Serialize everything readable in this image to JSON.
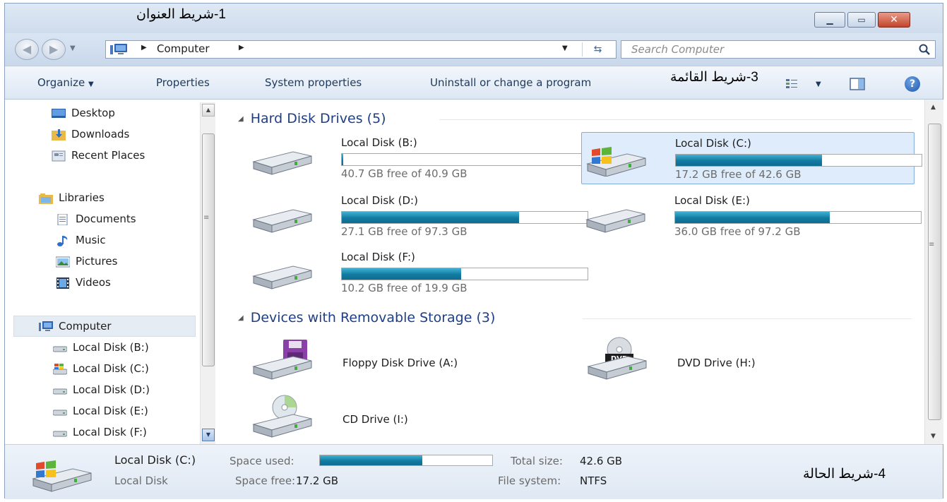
{
  "annotations": {
    "title_bar": "1-شريط العنوان",
    "menu_bar": "3-شريط القائمة",
    "status_bar": "4-شريط الحالة"
  },
  "address_bar": {
    "path": [
      "Computer"
    ],
    "search_placeholder": "Search Computer"
  },
  "command_bar": {
    "items": [
      "Organize",
      "Properties",
      "System properties",
      "Uninstall or change a program"
    ]
  },
  "navigation": {
    "favorites": [
      "Desktop",
      "Downloads",
      "Recent Places"
    ],
    "libraries_label": "Libraries",
    "libraries": [
      "Documents",
      "Music",
      "Pictures",
      "Videos"
    ],
    "computer_label": "Computer",
    "drives": [
      "Local Disk (B:)",
      "Local Disk (C:)",
      "Local Disk (D:)",
      "Local Disk (E:)",
      "Local Disk (F:)"
    ]
  },
  "groups": {
    "hard_disks_header": "Hard Disk Drives (5)",
    "removable_header": "Devices with Removable Storage (3)"
  },
  "hard_disks": [
    {
      "name": "Local Disk (B:)",
      "free_text": "40.7 GB free of 40.9 GB",
      "used_fraction": 0.005,
      "selected": false
    },
    {
      "name": "Local Disk (C:)",
      "free_text": "17.2 GB free of 42.6 GB",
      "used_fraction": 0.596,
      "selected": true
    },
    {
      "name": "Local Disk (D:)",
      "free_text": "27.1 GB free of 97.3 GB",
      "used_fraction": 0.721,
      "selected": false
    },
    {
      "name": "Local Disk (E:)",
      "free_text": "36.0 GB free of 97.2 GB",
      "used_fraction": 0.63,
      "selected": false
    },
    {
      "name": "Local Disk (F:)",
      "free_text": "10.2 GB free of 19.9 GB",
      "used_fraction": 0.487,
      "selected": false
    }
  ],
  "removable": [
    {
      "name": "Floppy Disk Drive (A:)",
      "icon": "floppy-drive-icon"
    },
    {
      "name": "DVD Drive (H:)",
      "icon": "dvd-drive-icon"
    },
    {
      "name": "CD Drive (I:)",
      "icon": "cd-drive-icon"
    }
  ],
  "details": {
    "name": "Local Disk (C:)",
    "type": "Local Disk",
    "space_used_label": "Space used:",
    "space_used_fraction": 0.596,
    "space_free_label": "Space free:",
    "space_free": "17.2 GB",
    "total_size_label": "Total size:",
    "total_size": "42.6 GB",
    "file_system_label": "File system:",
    "file_system": "NTFS"
  },
  "colors": {
    "bar_fill": "#1689b5",
    "header_text": "#1e3f86",
    "selection_bg": "#dfecfb"
  }
}
